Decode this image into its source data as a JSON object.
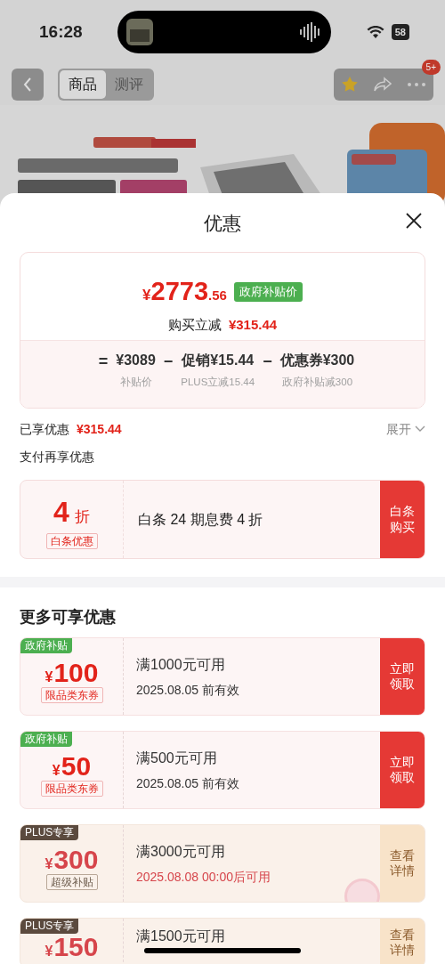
{
  "status_bar": {
    "time": "16:28",
    "battery": "58"
  },
  "nav": {
    "tabs": [
      {
        "label": "商品",
        "selected": true
      },
      {
        "label": "测评",
        "selected": false
      }
    ],
    "badge": "5+"
  },
  "sheet": {
    "title": "优惠",
    "price": {
      "symbol": "¥",
      "integer": "2773",
      "decimal": ".56",
      "tag": "政府补贴价",
      "saving_label": "购买立减",
      "saving": "¥315.44"
    },
    "formula": [
      {
        "op": "=",
        "value": "¥3089",
        "caption": "补贴价"
      },
      {
        "op": "−",
        "value": "促销¥15.44",
        "caption": "PLUS立减15.44"
      },
      {
        "op": "−",
        "value": "优惠券¥300",
        "caption": "政府补贴减300"
      }
    ],
    "enjoyed": {
      "label": "已享优惠",
      "amount": "¥315.44",
      "toggle": "展开",
      "expanded": false
    },
    "pay_section": {
      "title": "支付再享优惠",
      "offer": {
        "value": "4",
        "unit": "折",
        "tag": "白条优惠",
        "description": "白条 24 期息费 4 折",
        "button": "白条购买"
      }
    },
    "more_section": {
      "title": "更多可享优惠",
      "coupons": [
        {
          "kind": "gov",
          "badge": "政府补贴",
          "symbol": "¥",
          "amount": "100",
          "tag": "限品类东券",
          "condition": "满1000元可用",
          "validity": "2025.08.05 前有效",
          "button": "立即领取",
          "claimed": false
        },
        {
          "kind": "gov",
          "badge": "政府补贴",
          "symbol": "¥",
          "amount": "50",
          "tag": "限品类东券",
          "condition": "满500元可用",
          "validity": "2025.08.05 前有效",
          "button": "立即领取",
          "claimed": false
        },
        {
          "kind": "plus",
          "badge": "PLUS专享",
          "symbol": "¥",
          "amount": "300",
          "tag": "超级补贴",
          "condition": "满3000元可用",
          "validity": "2025.08.08 00:00后可用",
          "button": "查看详情",
          "claimed": true
        },
        {
          "kind": "plus",
          "badge": "PLUS专享",
          "symbol": "¥",
          "amount": "150",
          "condition": "满1500元可用",
          "button": "查看详情",
          "claimed": false
        }
      ]
    }
  }
}
